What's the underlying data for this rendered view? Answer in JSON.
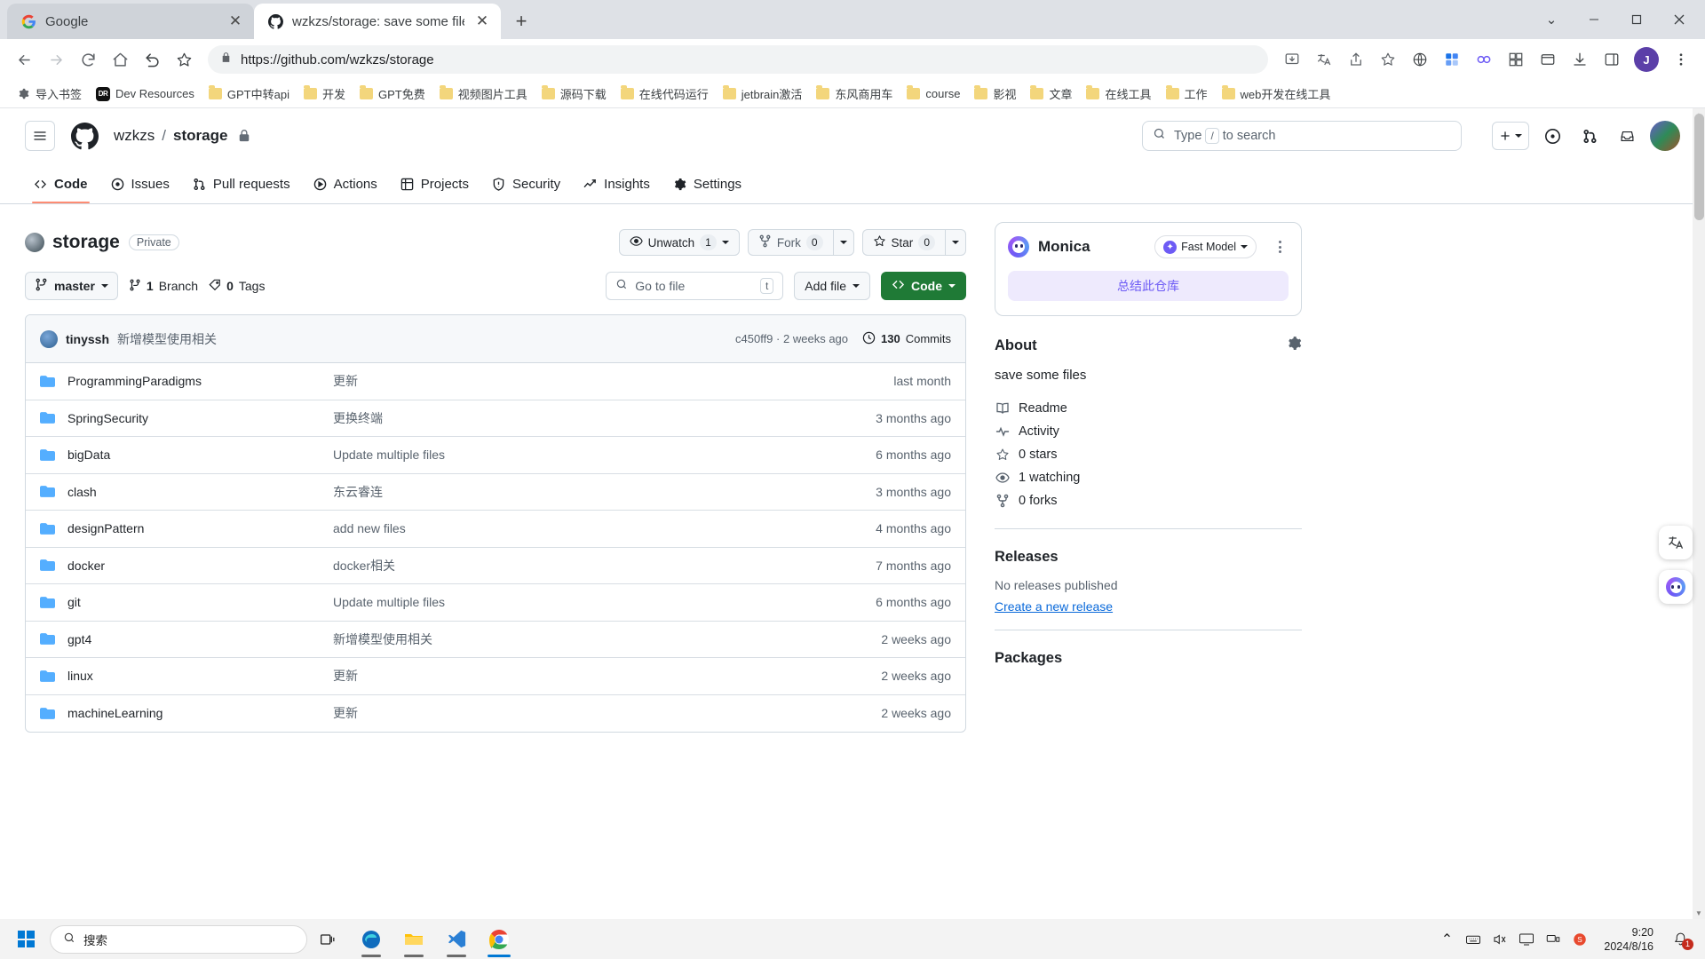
{
  "browser": {
    "tabs": [
      {
        "title": "Google",
        "favicon": "google-icon",
        "active": false
      },
      {
        "title": "wzkzs/storage: save some file",
        "favicon": "github-icon",
        "active": true
      }
    ],
    "new_tab_label": "+",
    "window_controls": {
      "minimize": "–",
      "maximize": "❐",
      "close": "✕",
      "chevron": "⌄"
    },
    "nav": {
      "back": "←",
      "forward": "→",
      "reload": "⟳",
      "home": "⌂",
      "history_back": "↶",
      "bookmark": "☆"
    },
    "omnibox": {
      "lock_icon": "lock-icon",
      "scheme": "https://",
      "host_path": "github.com/wzkzs/storage",
      "full_url": "https://github.com/wzkzs/storage"
    },
    "profile_initial": "J",
    "bookmarks": [
      {
        "label": "导入书签",
        "icon": "gear-icon"
      },
      {
        "label": "Dev Resources",
        "icon": "dr-icon"
      },
      {
        "label": "GPT中转api",
        "icon": "folder-icon"
      },
      {
        "label": "开发",
        "icon": "folder-icon"
      },
      {
        "label": "GPT免费",
        "icon": "folder-icon"
      },
      {
        "label": "视频图片工具",
        "icon": "folder-icon"
      },
      {
        "label": "源码下载",
        "icon": "folder-icon"
      },
      {
        "label": "在线代码运行",
        "icon": "folder-icon"
      },
      {
        "label": "jetbrain激活",
        "icon": "folder-icon"
      },
      {
        "label": "东风商用车",
        "icon": "folder-icon"
      },
      {
        "label": "course",
        "icon": "folder-icon"
      },
      {
        "label": "影视",
        "icon": "folder-icon"
      },
      {
        "label": "文章",
        "icon": "folder-icon"
      },
      {
        "label": "在线工具",
        "icon": "folder-icon"
      },
      {
        "label": "工作",
        "icon": "folder-icon"
      },
      {
        "label": "web开发在线工具",
        "icon": "folder-icon"
      }
    ]
  },
  "github": {
    "header": {
      "owner": "wzkzs",
      "separator": "/",
      "repo": "storage",
      "visibility_icon": "lock-icon",
      "search_placeholder": "Type",
      "search_placeholder_tail": "to search",
      "search_kbd": "/",
      "plus_label": "+",
      "icons": [
        "issues-icon",
        "pull-requests-icon",
        "inbox-icon"
      ]
    },
    "repo_nav": [
      {
        "label": "Code",
        "icon": "code-icon",
        "active": true
      },
      {
        "label": "Issues",
        "icon": "issue-opened-icon",
        "active": false
      },
      {
        "label": "Pull requests",
        "icon": "git-pull-request-icon",
        "active": false
      },
      {
        "label": "Actions",
        "icon": "play-icon",
        "active": false
      },
      {
        "label": "Projects",
        "icon": "table-icon",
        "active": false
      },
      {
        "label": "Security",
        "icon": "shield-icon",
        "active": false
      },
      {
        "label": "Insights",
        "icon": "graph-icon",
        "active": false
      },
      {
        "label": "Settings",
        "icon": "gear-icon",
        "active": false
      }
    ],
    "repo_title": {
      "name": "storage",
      "badge": "Private"
    },
    "repo_actions": {
      "watch_label": "Unwatch",
      "watch_count": "1",
      "fork_label": "Fork",
      "fork_count": "0",
      "star_label": "Star",
      "star_count": "0"
    },
    "toolbar": {
      "branch": "master",
      "branch_count": "1",
      "branch_word": "Branch",
      "tag_count": "0",
      "tag_word": "Tags",
      "goto_file_placeholder": "Go to file",
      "goto_file_kbd": "t",
      "add_file_label": "Add file",
      "code_label": "Code"
    },
    "commit_bar": {
      "author": "tinyssh",
      "message": "新增模型使用相关",
      "hash": "c450ff9",
      "separator": "·",
      "relative_time": "2 weeks ago",
      "commits_count": "130",
      "commits_word": "Commits"
    },
    "files": [
      {
        "name": "ProgrammingParadigms",
        "message": "更新",
        "time": "last month"
      },
      {
        "name": "SpringSecurity",
        "message": "更换终端",
        "time": "3 months ago"
      },
      {
        "name": "bigData",
        "message": "Update multiple files",
        "time": "6 months ago"
      },
      {
        "name": "clash",
        "message": "东云睿连",
        "time": "3 months ago"
      },
      {
        "name": "designPattern",
        "message": "add new files",
        "time": "4 months ago"
      },
      {
        "name": "docker",
        "message": "docker相关",
        "time": "7 months ago"
      },
      {
        "name": "git",
        "message": "Update multiple files",
        "time": "6 months ago"
      },
      {
        "name": "gpt4",
        "message": "新增模型使用相关",
        "time": "2 weeks ago"
      },
      {
        "name": "linux",
        "message": "更新",
        "time": "2 weeks ago"
      },
      {
        "name": "machineLearning",
        "message": "更新",
        "time": "2 weeks ago"
      }
    ],
    "sidebar": {
      "monica": {
        "name": "Monica",
        "model": "Fast Model",
        "cta": "总结此仓库"
      },
      "about": {
        "title": "About",
        "description": "save some files",
        "items": [
          {
            "label": "Readme",
            "icon": "book-icon"
          },
          {
            "label": "Activity",
            "icon": "pulse-icon"
          },
          {
            "label": "0 stars",
            "icon": "star-icon"
          },
          {
            "label": "1 watching",
            "icon": "eye-icon"
          },
          {
            "label": "0 forks",
            "icon": "fork-icon"
          }
        ]
      },
      "releases": {
        "title": "Releases",
        "note": "No releases published",
        "link": "Create a new release"
      },
      "packages": {
        "title": "Packages"
      }
    }
  },
  "taskbar": {
    "search_placeholder": "搜索",
    "apps": [
      {
        "name": "task-view-icon"
      },
      {
        "name": "edge-icon"
      },
      {
        "name": "file-explorer-icon"
      },
      {
        "name": "vscode-icon"
      },
      {
        "name": "chrome-icon"
      }
    ],
    "tray": {
      "chevron": "⌃",
      "keyboard": "keyboard-icon",
      "volume": "volume-icon",
      "display": "display-icon",
      "network": "network-icon",
      "s_icon": "sogou-icon"
    },
    "clock": {
      "time": "9:20",
      "date": "2024/8/16"
    },
    "notification_count": "1"
  }
}
